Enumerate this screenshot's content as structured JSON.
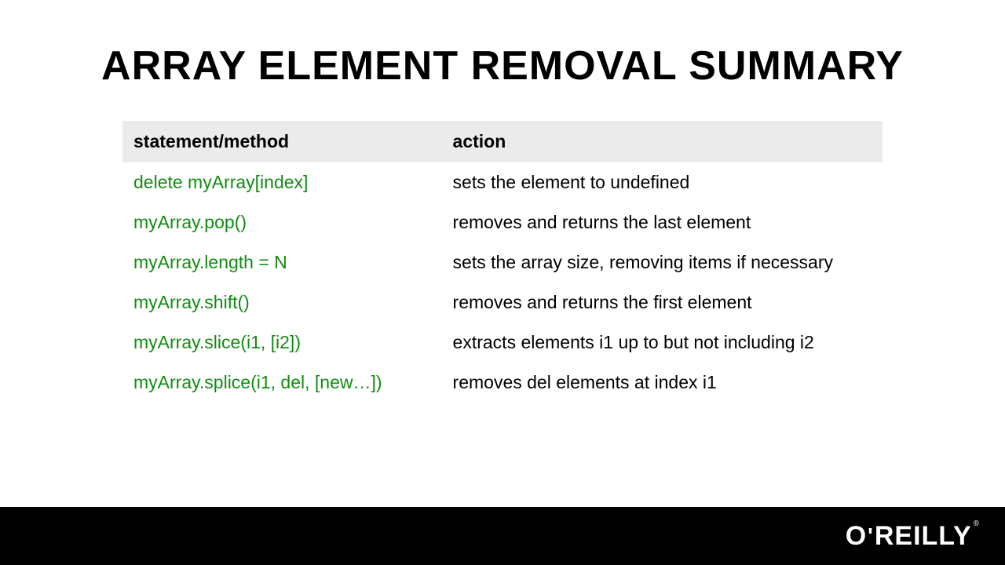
{
  "title": "ARRAY ELEMENT REMOVAL SUMMARY",
  "headers": {
    "col1": "statement/method",
    "col2": "action"
  },
  "rows": [
    {
      "method": "delete myArray[index]",
      "action": "sets the element to undefined"
    },
    {
      "method": "myArray.pop()",
      "action": "removes and returns the last element"
    },
    {
      "method": "myArray.length = N",
      "action": "sets the array size, removing items if necessary"
    },
    {
      "method": "myArray.shift()",
      "action": "removes and returns the first element"
    },
    {
      "method": "myArray.slice(i1, [i2])",
      "action": "extracts elements i1 up to but not including i2"
    },
    {
      "method": "myArray.splice(i1, del, [new…])",
      "action": "removes del elements at index i1"
    }
  ],
  "footer": {
    "brand": "O'REILLY"
  }
}
